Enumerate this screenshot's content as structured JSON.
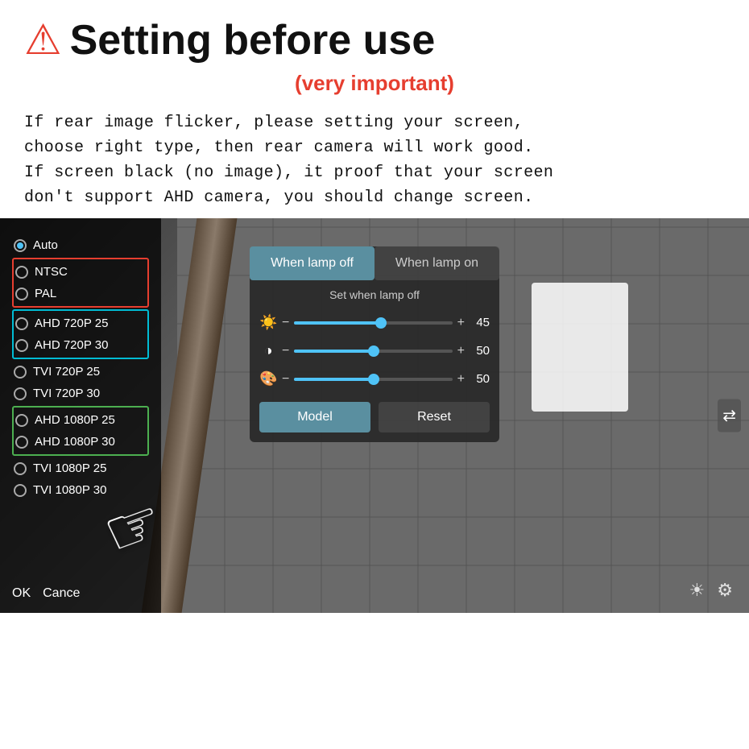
{
  "header": {
    "warning_icon": "⚠",
    "title": "Setting before use",
    "subtitle": "(very important)",
    "description_line1": "If rear image flicker, please setting your screen,",
    "description_line2": "choose right type, then rear camera will work good.",
    "description_line3": "If screen black (no image), it proof that your screen",
    "description_line4": "don't support AHD camera, you should change screen."
  },
  "menu": {
    "items": [
      {
        "label": "Auto",
        "selected": true
      },
      {
        "label": "NTSC",
        "selected": false,
        "box": "red"
      },
      {
        "label": "PAL",
        "selected": false,
        "box": "red"
      },
      {
        "label": "AHD 720P 25",
        "selected": false,
        "box": "cyan"
      },
      {
        "label": "AHD 720P 30",
        "selected": false,
        "box": "cyan"
      },
      {
        "label": "TVI 720P 25",
        "selected": false,
        "box": "none"
      },
      {
        "label": "TVI 720P 30",
        "selected": false,
        "box": "none"
      },
      {
        "label": "AHD 1080P 25",
        "selected": false,
        "box": "green"
      },
      {
        "label": "AHD 1080P 30",
        "selected": false,
        "box": "green"
      },
      {
        "label": "TVI 1080P 25",
        "selected": false,
        "box": "none"
      },
      {
        "label": "TVI 1080P 30",
        "selected": false,
        "box": "none"
      }
    ],
    "ok_label": "OK",
    "cancel_label": "Cance"
  },
  "settings_panel": {
    "tab_lamp_off": "When lamp off",
    "tab_lamp_on": "When lamp on",
    "section_title": "Set when lamp off",
    "sliders": [
      {
        "icon": "☀",
        "value": 45,
        "percent": 55
      },
      {
        "icon": "◑",
        "value": 50,
        "percent": 50
      },
      {
        "icon": "🎨",
        "value": 50,
        "percent": 50
      }
    ],
    "model_btn": "Model",
    "reset_btn": "Reset"
  }
}
